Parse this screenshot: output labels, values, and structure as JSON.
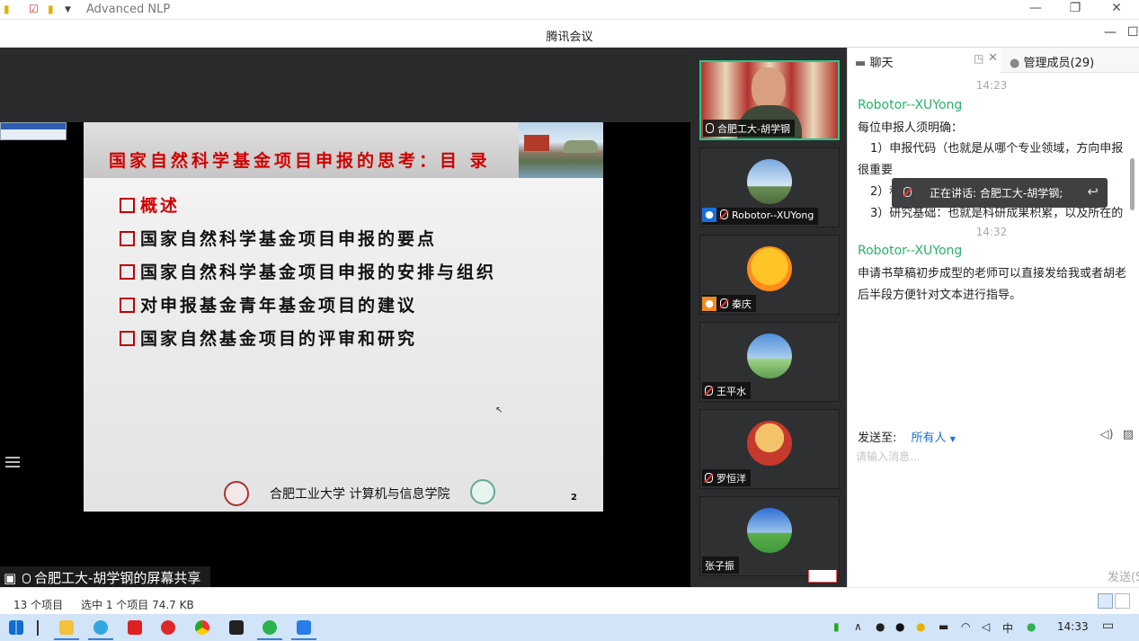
{
  "explorer": {
    "title": "Advanced NLP",
    "minimize": "—",
    "restore": "❐",
    "close": "✕"
  },
  "meeting": {
    "title": "腾讯会议",
    "minimize": "—",
    "maximize": "☐"
  },
  "slide": {
    "title": "国家自然科学基金项目申报的思考：目 录",
    "items": [
      "概述",
      "国家自然科学基金项目申报的要点",
      "国家自然科学基金项目申报的安排与组织",
      "对申报基金青年基金项目的建议",
      "国家自然基金项目的评审和研究"
    ],
    "footer": "合肥工业大学 计算机与信息学院",
    "page": "2"
  },
  "share_label": "合肥工大-胡学钢的屏幕共享",
  "participants": [
    {
      "name": "合肥工大-胡学钢",
      "avatar_colors": [
        "#b3332e",
        "#e8d7b8"
      ]
    },
    {
      "name": "Robotor--XUYong",
      "avatar_colors": [
        "#7aa9dd",
        "#d5e6f5"
      ]
    },
    {
      "name": "秦庆",
      "avatar_colors": [
        "#ffc425",
        "#ff8c1a"
      ]
    },
    {
      "name": "王平水",
      "avatar_colors": [
        "#4f8fd6",
        "#9fd38a"
      ]
    },
    {
      "name": "罗恒洋",
      "avatar_colors": [
        "#f3c36a",
        "#c7392c"
      ]
    },
    {
      "name": "张子振",
      "avatar_colors": [
        "#2d6fd2",
        "#3f9a3a"
      ]
    }
  ],
  "chat": {
    "tab_chat": "聊天",
    "tab_members": "管理成员(29)",
    "messages": [
      {
        "time": "14:23",
        "sender": "Robotor--XUYong",
        "lines": [
          "每位申报人须明确：",
          "1）申报代码（也就是从哪个专业领域，方向申报",
          "很重要",
          "2）科学属性选择",
          "3）研究基础：也就是科研成果积累，以及所在的"
        ]
      },
      {
        "time": "14:32",
        "sender": "Robotor--XUYong",
        "lines": [
          "申请书草稿初步成型的老师可以直接发给我或者胡老",
          "后半段方便针对文本进行指导。"
        ]
      }
    ],
    "speaking": "正在讲话: 合肥工大-胡学钢;",
    "send_to_label": "发送至:",
    "send_to_target": "所有人",
    "input_placeholder": "请输入消息...",
    "send_button": "发送(S"
  },
  "status": {
    "items_count": "13 个项目",
    "selected": "选中 1 个项目  74.7 KB"
  },
  "taskbar": {
    "time": "14:33",
    "ime": "中"
  },
  "colors": {
    "accent_green": "#29b36a",
    "active_tile_border": "#27c88a",
    "slide_title": "#d10000",
    "link_blue": "#1a6fd8"
  }
}
